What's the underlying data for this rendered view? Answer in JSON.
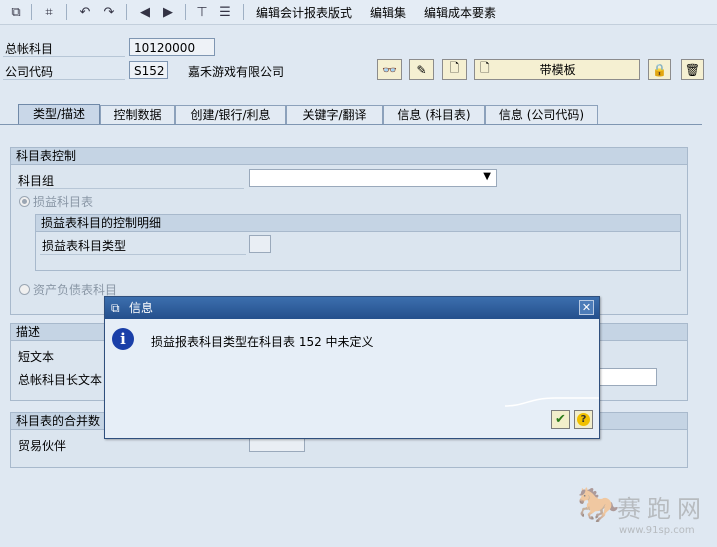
{
  "toolbar": {
    "menu_items": [
      "编辑会计报表版式",
      "编辑集",
      "编辑成本要素"
    ]
  },
  "header": {
    "gl_account_label": "总帐科目",
    "gl_account_value": "10120000",
    "company_code_label": "公司代码",
    "company_code_value": "S152",
    "company_name": "嘉禾游戏有限公司",
    "with_template_label": "带模板"
  },
  "tabs": [
    {
      "label": "类型/描述",
      "active": true
    },
    {
      "label": "控制数据",
      "active": false
    },
    {
      "label": "创建/银行/利息",
      "active": false
    },
    {
      "label": "关键字/翻译",
      "active": false
    },
    {
      "label": "信息 (科目表)",
      "active": false
    },
    {
      "label": "信息 (公司代码)",
      "active": false
    }
  ],
  "coa_control": {
    "title": "科目表控制",
    "account_group_label": "科目组",
    "pl_account_label": "损益科目表",
    "pl_detail_title": "损益表科目的控制明细",
    "pl_type_label": "损益表科目类型",
    "bs_account_label": "资产负债表科目"
  },
  "description": {
    "title": "描述",
    "short_text_label": "短文本",
    "long_text_label": "总帐科目长文本"
  },
  "consolidation": {
    "title": "科目表的合并数",
    "trading_partner_label": "贸易伙伴"
  },
  "dialog": {
    "title": "信息",
    "message": "损益报表科目类型在科目表 152 中未定义"
  },
  "watermark": {
    "text": "赛跑网",
    "url": "www.91sp.com"
  },
  "colors": {
    "title_bar": "#2c5b9a",
    "tab_active": "#c9d7e8",
    "background": "#dfe8f2",
    "info_icon": "#1a3fa8"
  }
}
